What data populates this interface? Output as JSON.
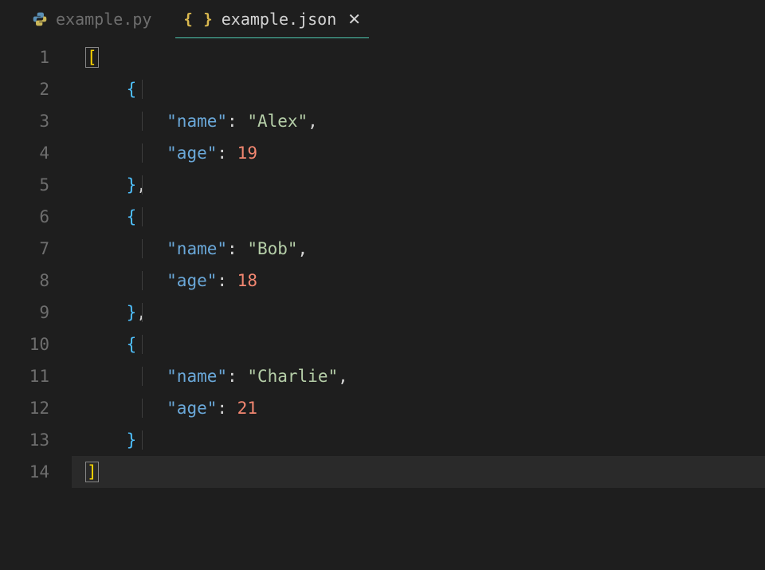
{
  "tabs": {
    "inactive": {
      "label": "example.py",
      "icon": "python-icon"
    },
    "active": {
      "label": "example.json",
      "icon": "json-icon",
      "icon_text": "{ }"
    }
  },
  "code": {
    "key_name": "\"name\"",
    "key_age": "\"age\"",
    "val_alex": "\"Alex\"",
    "val_bob": "\"Bob\"",
    "val_charlie": "\"Charlie\"",
    "num_19": "19",
    "num_18": "18",
    "num_21": "21"
  },
  "line_numbers": [
    "1",
    "2",
    "3",
    "4",
    "5",
    "6",
    "7",
    "8",
    "9",
    "10",
    "11",
    "12",
    "13",
    "14"
  ]
}
